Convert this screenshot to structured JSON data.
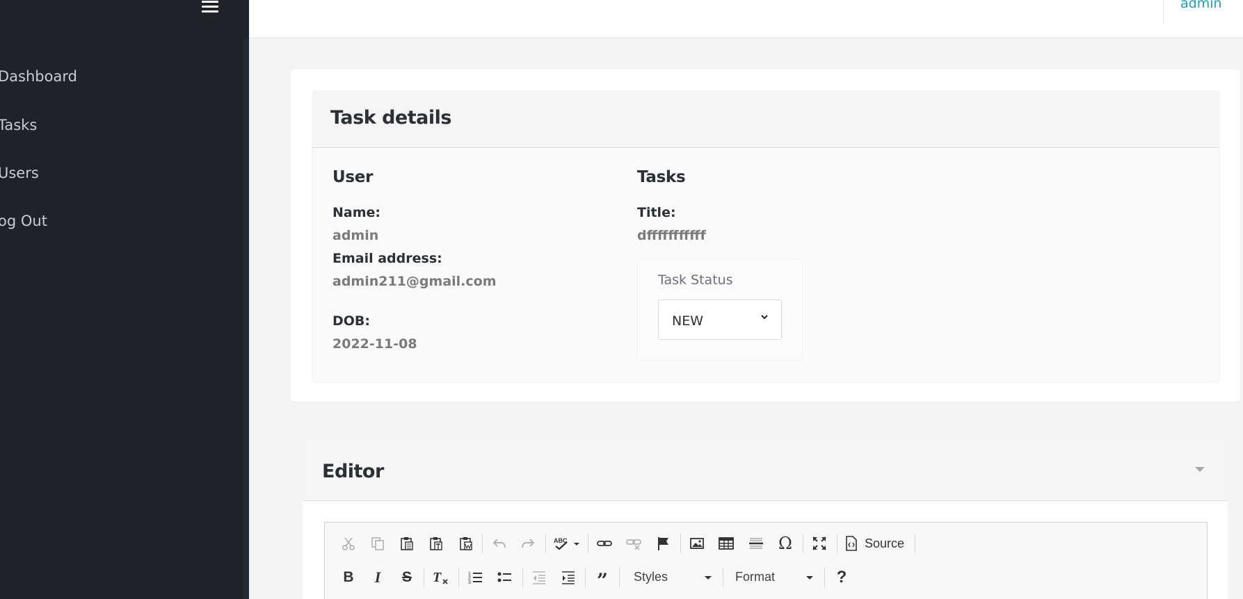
{
  "sidebar": {
    "items": [
      {
        "label": "Dashboard"
      },
      {
        "label": "Tasks"
      },
      {
        "label": "Users"
      },
      {
        "label": "og Out"
      }
    ]
  },
  "topbar": {
    "user": "admin"
  },
  "task_card": {
    "title": "Task details",
    "user_section": {
      "title": "User",
      "name_label": "Name:",
      "name_value": "admin",
      "email_label": "Email address:",
      "email_value": "admin211@gmail.com",
      "dob_label": "DOB:",
      "dob_value": "2022-11-08"
    },
    "tasks_section": {
      "title": "Tasks",
      "title_label": "Title:",
      "title_value": "dfffffffffff",
      "status_label": "Task Status",
      "status_value": "NEW"
    }
  },
  "editor": {
    "title": "Editor",
    "toolbar": {
      "source_label": "Source",
      "styles_label": "Styles",
      "format_label": "Format"
    }
  },
  "colors": {
    "sidebar_bg": "#1e2229",
    "accent_link": "#1a9fc9",
    "page_bg": "#f4f4f6"
  }
}
